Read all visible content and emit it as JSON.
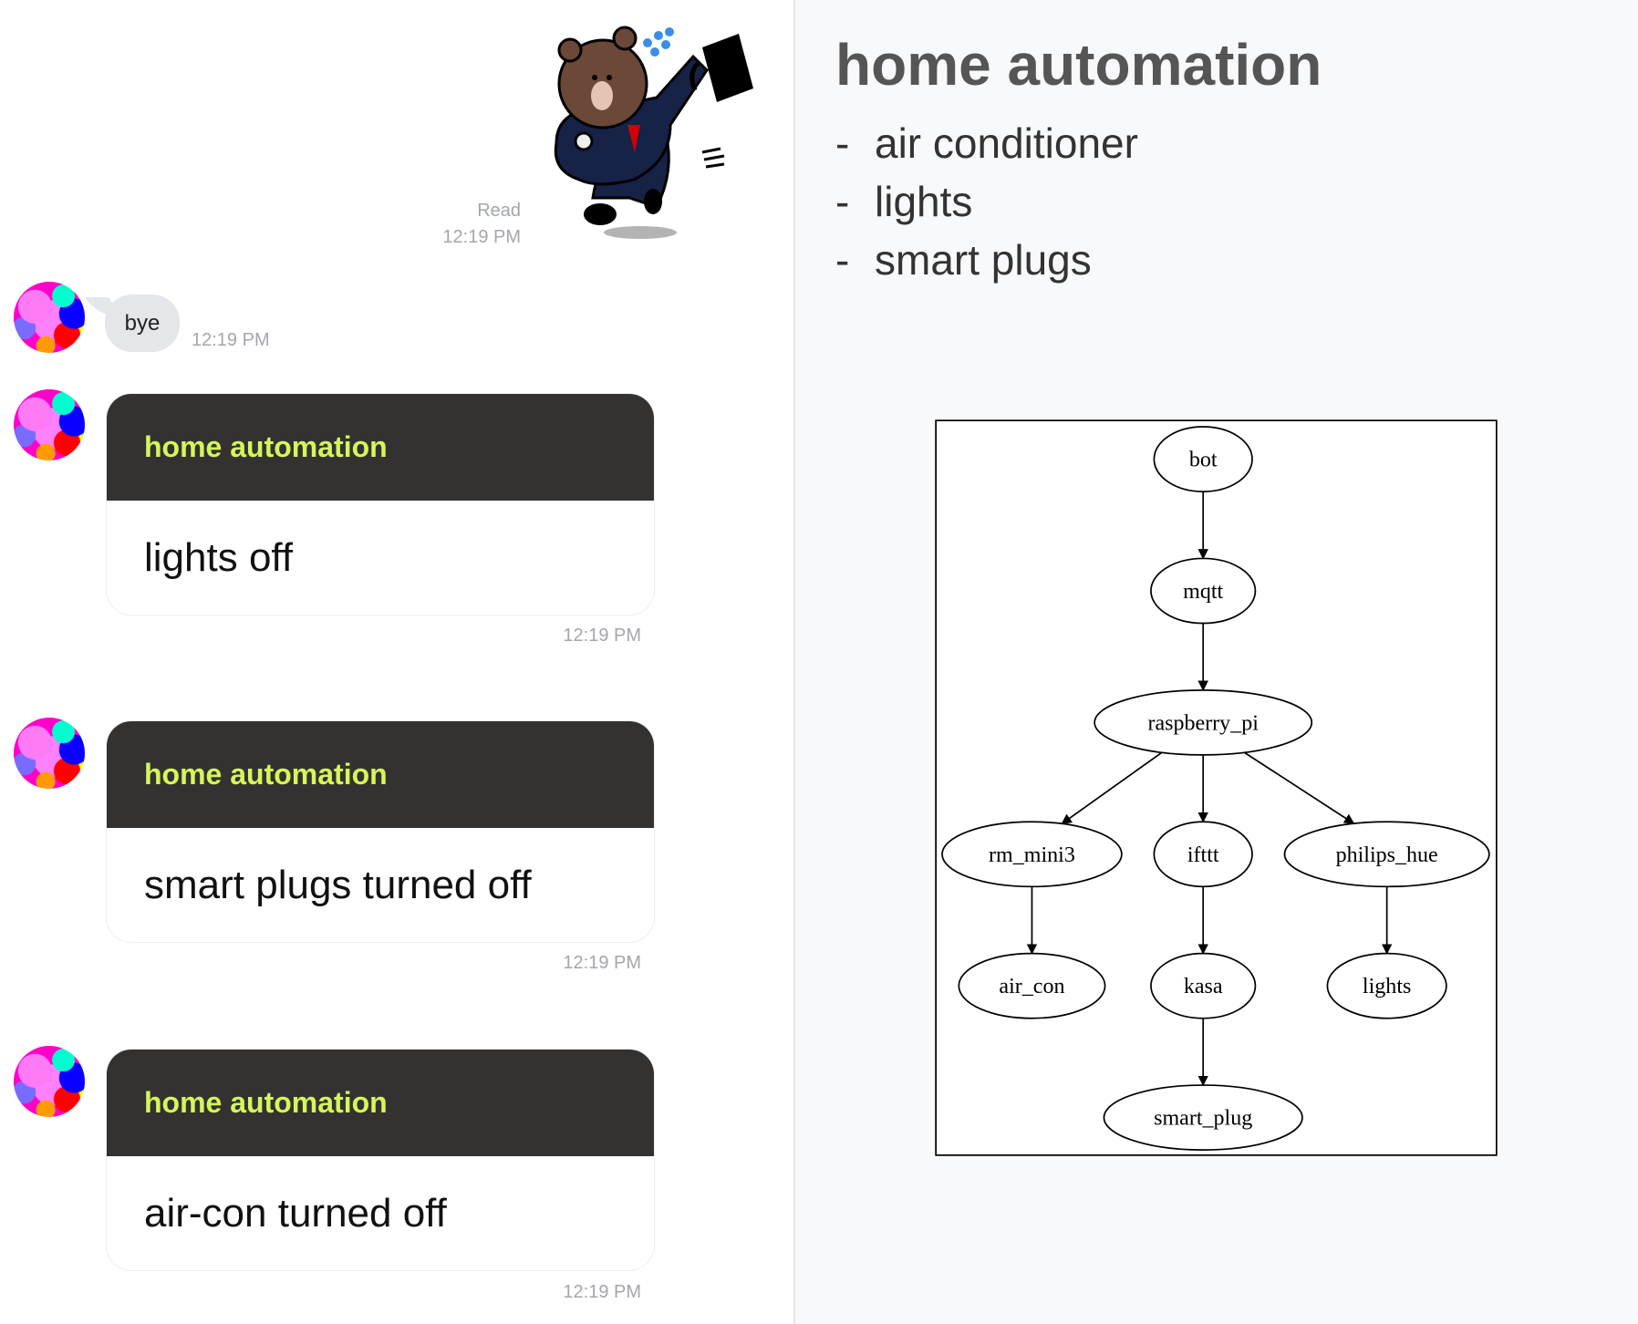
{
  "chat": {
    "sticker": {
      "name": "brown-bear-running-late-sticker",
      "read_label": "Read",
      "time": "12:19 PM"
    },
    "bye_message": {
      "text": "bye",
      "time": "12:19 PM"
    },
    "cards": [
      {
        "header": "home automation",
        "body": "lights off",
        "time": "12:19 PM"
      },
      {
        "header": "home automation",
        "body": "smart plugs turned off",
        "time": "12:19 PM"
      },
      {
        "header": "home automation",
        "body": "air-con turned off",
        "time": "12:19 PM"
      }
    ]
  },
  "slide": {
    "title": "home automation",
    "items": [
      {
        "dash": "-",
        "label": "air conditioner"
      },
      {
        "dash": "-",
        "label": "lights"
      },
      {
        "dash": "-",
        "label": "smart plugs"
      }
    ]
  },
  "diagram": {
    "nodes": [
      "bot",
      "mqtt",
      "raspberry_pi",
      "rm_mini3",
      "ifttt",
      "philips_hue",
      "air_con",
      "kasa",
      "lights",
      "smart_plug"
    ],
    "edges": [
      [
        "bot",
        "mqtt"
      ],
      [
        "mqtt",
        "raspberry_pi"
      ],
      [
        "raspberry_pi",
        "rm_mini3"
      ],
      [
        "raspberry_pi",
        "ifttt"
      ],
      [
        "raspberry_pi",
        "philips_hue"
      ],
      [
        "rm_mini3",
        "air_con"
      ],
      [
        "ifttt",
        "kasa"
      ],
      [
        "philips_hue",
        "lights"
      ],
      [
        "kasa",
        "smart_plug"
      ]
    ]
  },
  "colors": {
    "card_header_bg": "#333231",
    "card_header_text": "#d6f55a",
    "bubble_bg": "#e4e6ea",
    "timestamp": "#a3a6ab"
  }
}
